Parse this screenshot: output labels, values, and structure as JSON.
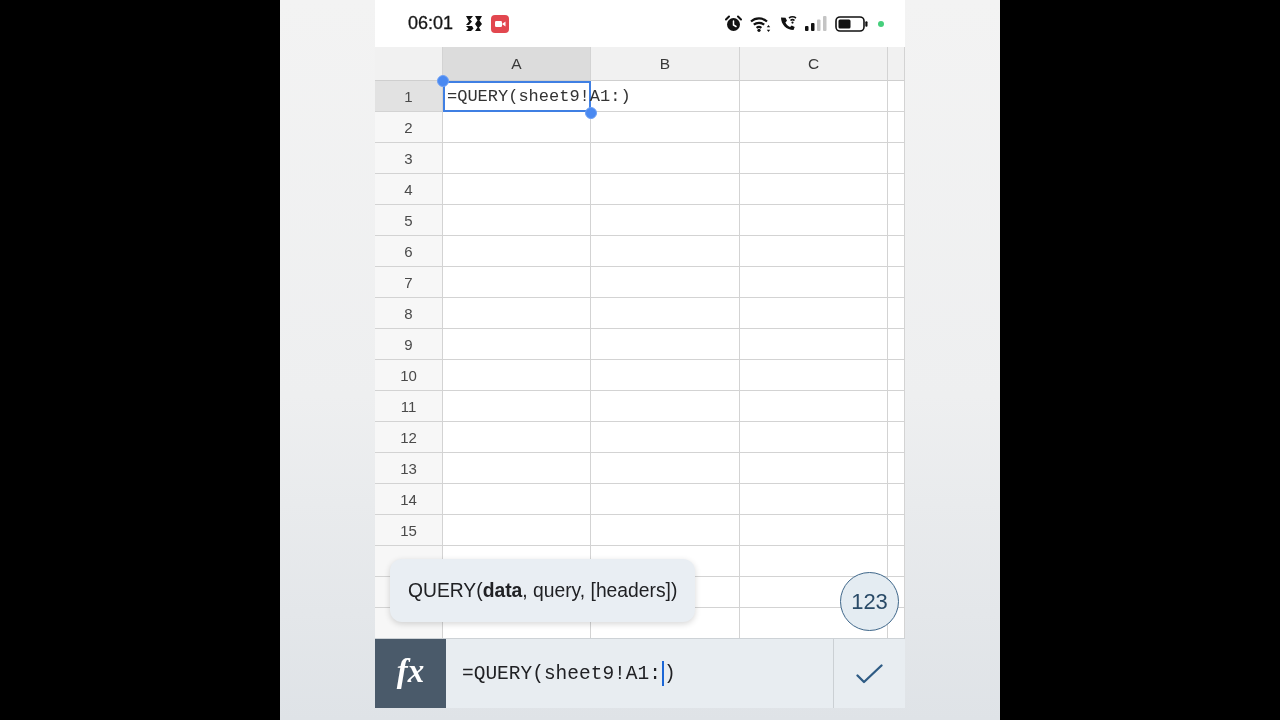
{
  "status_bar": {
    "time": "06:01"
  },
  "sheet": {
    "columns": [
      {
        "label": "A",
        "selected": true
      },
      {
        "label": "B",
        "selected": false
      },
      {
        "label": "C",
        "selected": false
      }
    ],
    "rows": [
      {
        "label": "1",
        "selected": true,
        "cells": [
          {
            "value": "=QUERY(sheet9!A1:)",
            "selected": true
          }
        ]
      },
      {
        "label": "2",
        "selected": false
      },
      {
        "label": "3",
        "selected": false
      },
      {
        "label": "4",
        "selected": false
      },
      {
        "label": "5",
        "selected": false
      },
      {
        "label": "6",
        "selected": false
      },
      {
        "label": "7",
        "selected": false
      },
      {
        "label": "8",
        "selected": false
      },
      {
        "label": "9",
        "selected": false
      },
      {
        "label": "10",
        "selected": false
      },
      {
        "label": "11",
        "selected": false
      },
      {
        "label": "12",
        "selected": false
      },
      {
        "label": "13",
        "selected": false
      },
      {
        "label": "14",
        "selected": false
      },
      {
        "label": "15",
        "selected": false
      },
      {
        "selected": false
      },
      {
        "selected": false
      },
      {
        "selected": false
      }
    ]
  },
  "function_hint": "QUERY(**data**, query, [headers])",
  "keyboard_toggle": "123",
  "formula_bar": {
    "function_button": "fx",
    "value_before_cursor": "=QUERY(sheet9!A1:",
    "value_after_cursor": ")"
  }
}
